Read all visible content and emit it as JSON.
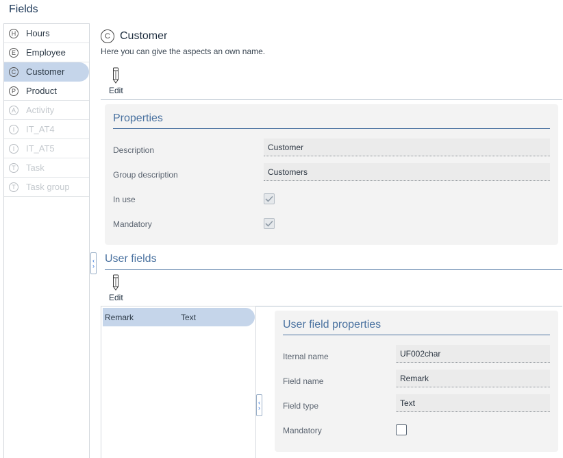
{
  "page": {
    "title": "Fields"
  },
  "nav": {
    "items": [
      {
        "letter": "H",
        "label": "Hours"
      },
      {
        "letter": "E",
        "label": "Employee"
      },
      {
        "letter": "C",
        "label": "Customer"
      },
      {
        "letter": "P",
        "label": "Product"
      },
      {
        "letter": "A",
        "label": "Activity"
      },
      {
        "letter": "I",
        "label": "IT_AT4"
      },
      {
        "letter": "I",
        "label": "IT_AT5"
      },
      {
        "letter": "T",
        "label": "Task"
      },
      {
        "letter": "T",
        "label": "Task group"
      }
    ],
    "selected": "Customer"
  },
  "header": {
    "icon_letter": "C",
    "title": "Customer",
    "subtitle": "Here you can give the aspects an own name."
  },
  "toolbar": {
    "edit_label": "Edit"
  },
  "properties": {
    "title": "Properties",
    "description_label": "Description",
    "description_value": "Customer",
    "group_description_label": "Group description",
    "group_description_value": "Customers",
    "in_use_label": "In use",
    "mandatory_label": "Mandatory"
  },
  "user_fields": {
    "title": "User fields",
    "edit_label": "Edit",
    "rows": [
      {
        "name": "Remark",
        "type": "Text"
      }
    ]
  },
  "user_field_properties": {
    "title": "User field properties",
    "internal_name_label": "Iternal name",
    "internal_name_value": "UF002char",
    "field_name_label": "Field name",
    "field_name_value": "Remark",
    "field_type_label": "Field type",
    "field_type_value": "Text",
    "mandatory_label": "Mandatory"
  },
  "icons": {
    "letter": "circle-letter-icon",
    "edit": "pencil-icon",
    "check": "checkmark-icon",
    "collapse": "chevron-left-right-icon"
  },
  "colors": {
    "accent": "#4a72a0",
    "selection": "#c5d5ea",
    "panel": "#f3f3f3"
  }
}
